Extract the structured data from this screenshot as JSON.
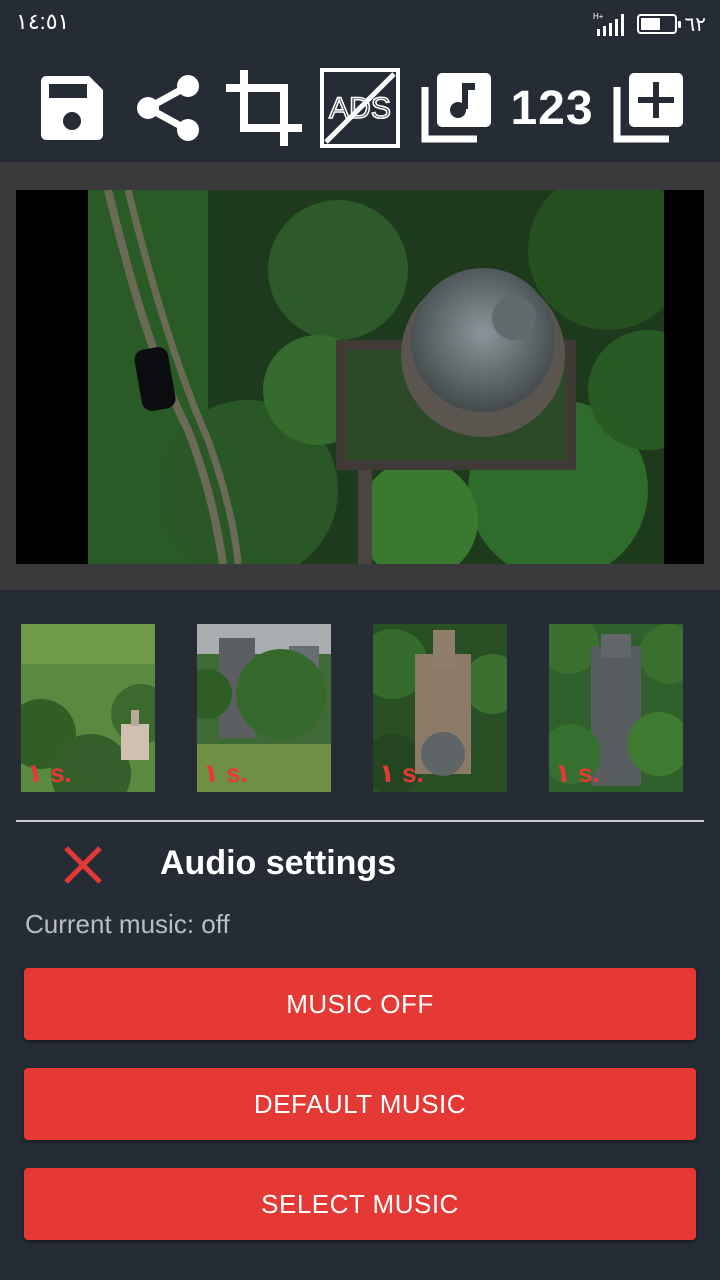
{
  "status_bar": {
    "time": "١٤:٥١",
    "network_type": "H+",
    "battery_percent": "٦٢",
    "battery_level": 0.62
  },
  "toolbar": {
    "buttons": [
      {
        "icon": "save-icon"
      },
      {
        "icon": "share-icon"
      },
      {
        "icon": "crop-icon"
      },
      {
        "icon": "no-ads-icon",
        "text": "ADS"
      },
      {
        "icon": "music-library-icon"
      },
      {
        "icon": "counter",
        "text": "123"
      },
      {
        "icon": "add-photo-icon"
      }
    ]
  },
  "thumbnails": [
    {
      "duration": "١ s."
    },
    {
      "duration": "١ s."
    },
    {
      "duration": "١ s."
    },
    {
      "duration": "١ s."
    }
  ],
  "audio_settings": {
    "title": "Audio settings",
    "current_music": "Current music: off",
    "buttons": {
      "music_off": "MUSIC OFF",
      "default_music": "DEFAULT MUSIC",
      "select_music": "SELECT MUSIC"
    }
  },
  "colors": {
    "background": "#252c35",
    "accent": "#e53935",
    "preview_panel": "#3a3a3c",
    "secondary_text": "#b8bec6"
  }
}
